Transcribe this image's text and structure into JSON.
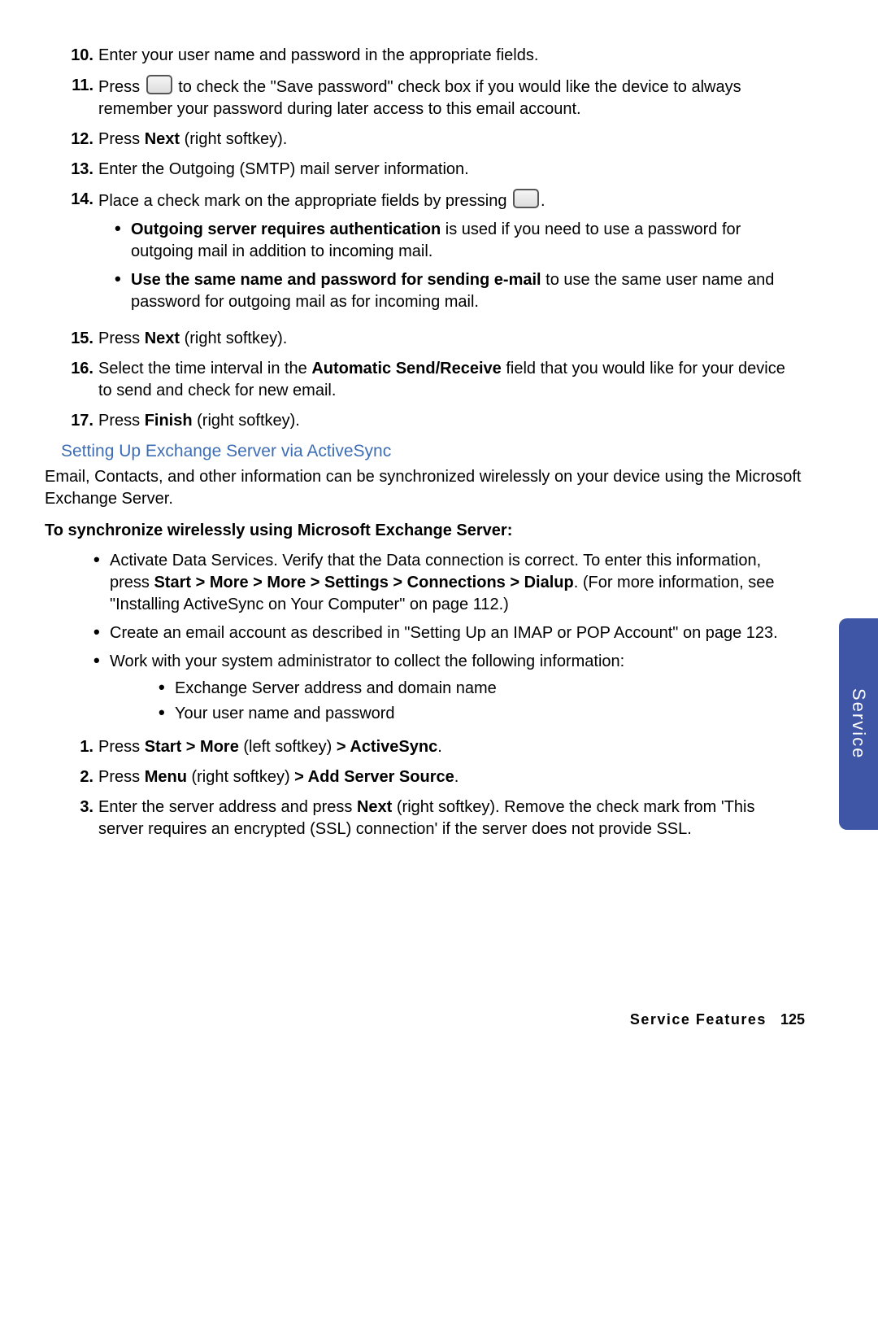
{
  "steps_a": {
    "n10": "10.",
    "t10": "Enter your user name and password in the appropriate fields.",
    "n11": "11.",
    "t11a": "Press ",
    "t11b": " to check the \"Save password\" check box if you would like the device to always remember your password during later access to this email account.",
    "n12": "12.",
    "t12a": "Press ",
    "t12b": "Next",
    "t12c": " (right softkey).",
    "n13": "13.",
    "t13": "Enter the Outgoing (SMTP) mail server information.",
    "n14": "14.",
    "t14a": "Place a check mark on the appropriate fields by pressing ",
    "t14b": ".",
    "b1a": "Outgoing server requires authentication",
    "b1b": " is used if you need to use a password for outgoing mail in addition to incoming mail.",
    "b2a": "Use the same name and password for sending e-mail",
    "b2b": " to use the same user name and password for outgoing mail as for incoming mail.",
    "n15": "15.",
    "t15a": "Press ",
    "t15b": "Next",
    "t15c": " (right softkey).",
    "n16": "16.",
    "t16a": "Select the time interval in the ",
    "t16b": "Automatic Send/Receive",
    "t16c": " field that you would like for your device to send and check for new email.",
    "n17": "17.",
    "t17a": "Press ",
    "t17b": "Finish",
    "t17c": " (right softkey)."
  },
  "section": {
    "heading": "Setting Up Exchange Server via ActiveSync",
    "para": "Email, Contacts, and other information can be synchronized wirelessly on your device using the Microsoft Exchange Server.",
    "subheading": "To synchronize wirelessly using Microsoft Exchange Server:"
  },
  "bullets_b": {
    "b1a": "Activate Data Services. Verify that the Data connection is correct. To enter this information, press ",
    "b1b": "Start > More > More > Settings > Connections > Dialup",
    "b1c": ". (For more information, see \"Installing ActiveSync on Your Computer\" on page 112.)",
    "b2": "Create an email account as described in \"Setting Up an IMAP or POP Account\" on page 123.",
    "b3": "Work with your system administrator to collect the following information:",
    "s1": "Exchange Server address and domain name",
    "s2": "Your user name and password"
  },
  "steps_c": {
    "n1": "1.",
    "t1a": "Press ",
    "t1b": "Start > More ",
    "t1c": "(left softkey) ",
    "t1d": "> ActiveSync",
    "t1e": ".",
    "n2": "2.",
    "t2a": "Press ",
    "t2b": "Menu",
    "t2c": " (right softkey) ",
    "t2d": "> Add Server Source",
    "t2e": ".",
    "n3": "3.",
    "t3a": "Enter the server address and press ",
    "t3b": "Next",
    "t3c": " (right softkey). Remove the check mark from 'This server requires an encrypted (SSL) connection' if the server does not provide SSL."
  },
  "side_tab": "Service",
  "footer": {
    "label": "Service Features",
    "page": "125"
  }
}
